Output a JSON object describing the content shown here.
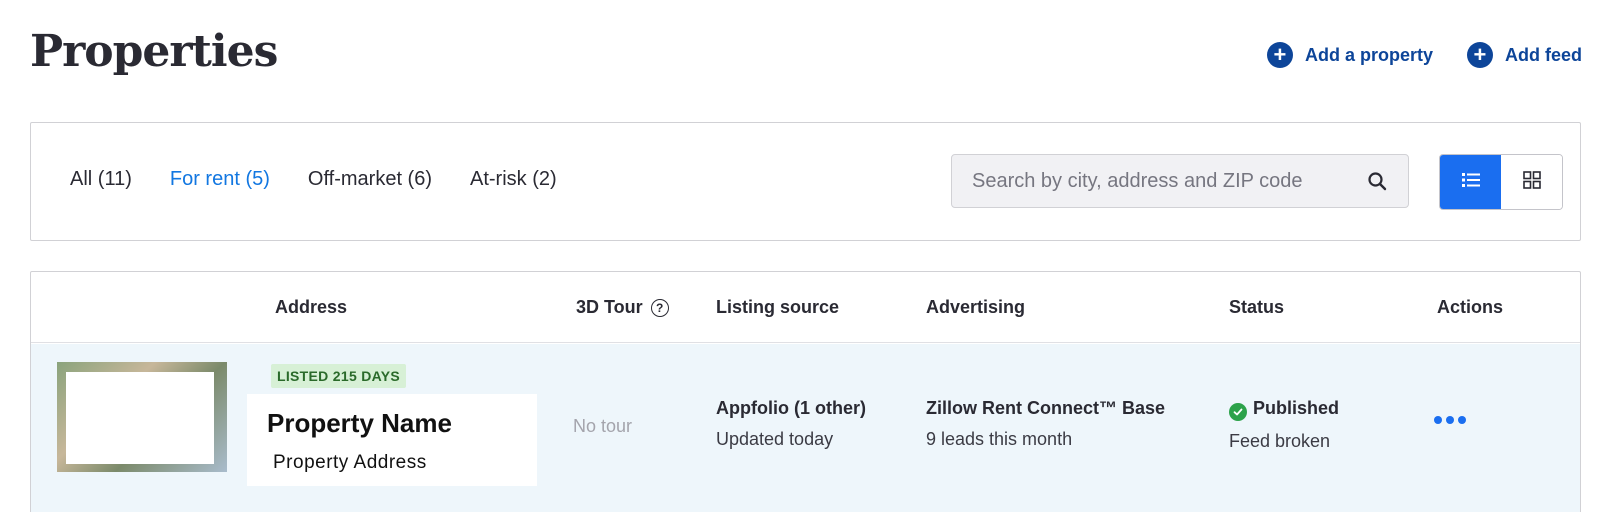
{
  "page": {
    "title": "Properties"
  },
  "header_actions": [
    {
      "label": "Add a property",
      "icon": "plus-circle-icon"
    },
    {
      "label": "Add feed",
      "icon": "plus-circle-icon"
    }
  ],
  "filters": {
    "tabs": [
      {
        "label": "All (11)",
        "active": false
      },
      {
        "label": "For rent (5)",
        "active": true
      },
      {
        "label": "Off-market (6)",
        "active": false
      },
      {
        "label": "At-risk (2)",
        "active": false
      }
    ],
    "search": {
      "placeholder": "Search by city, address and ZIP code",
      "value": ""
    },
    "view_toggle": {
      "selected": "list",
      "options": [
        "list",
        "grid"
      ]
    }
  },
  "table": {
    "columns": {
      "address": "Address",
      "tour": "3D Tour",
      "tour_help": "?",
      "listing_source": "Listing source",
      "advertising": "Advertising",
      "status": "Status",
      "actions": "Actions"
    },
    "rows": [
      {
        "badge": "LISTED 215 DAYS",
        "name": "Property Name",
        "address": "Property Address",
        "tour": "No tour",
        "listing_source": "Appfolio (1 other)",
        "listing_updated": "Updated today",
        "advertising": "Zillow Rent Connect™ Base",
        "leads": "9 leads this month",
        "status": "Published",
        "status_detail": "Feed broken"
      }
    ]
  },
  "colors": {
    "brand_dark": "#0d4599",
    "accent": "#1a6ef0",
    "active_tab": "#1277e1",
    "row_highlight": "#eef6fb",
    "badge_bg": "#d7f0d6",
    "success": "#2ca24a"
  }
}
